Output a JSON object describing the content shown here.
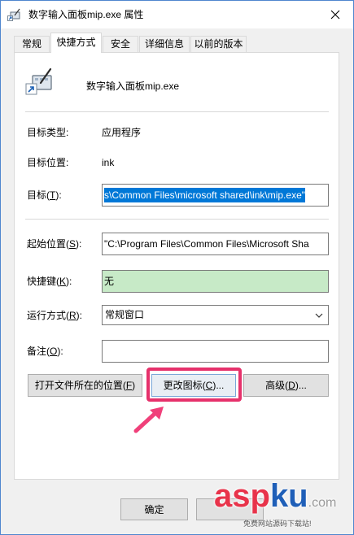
{
  "window": {
    "title": "数字输入面板mip.exe 属性"
  },
  "tabs": [
    {
      "label": "常规"
    },
    {
      "label": "快捷方式",
      "selected": true
    },
    {
      "label": "安全"
    },
    {
      "label": "详细信息"
    },
    {
      "label": "以前的版本"
    }
  ],
  "app": {
    "name": "数字输入面板mip.exe",
    "icon": "shortcut-pen-tablet-icon"
  },
  "fields": {
    "target_type": {
      "label": "目标类型:",
      "value": "应用程序"
    },
    "target_location": {
      "label": "目标位置:",
      "value": "ink"
    },
    "target": {
      "label_prefix": "目标(",
      "label_key": "T",
      "label_suffix": "):",
      "value": "s\\Common Files\\microsoft shared\\ink\\mip.exe\""
    },
    "start_in": {
      "label_prefix": "起始位置(",
      "label_key": "S",
      "label_suffix": "):",
      "value": "\"C:\\Program Files\\Common Files\\Microsoft Sha"
    },
    "shortcut_key": {
      "label_prefix": "快捷键(",
      "label_key": "K",
      "label_suffix": "):",
      "value": "无"
    },
    "run": {
      "label_prefix": "运行方式(",
      "label_key": "R",
      "label_suffix": "):",
      "value": "常规窗口"
    },
    "comment": {
      "label_prefix": "备注(",
      "label_key": "O",
      "label_suffix": "):"
    }
  },
  "buttons": {
    "open_location": {
      "prefix": "打开文件所在的位置(",
      "key": "F",
      "suffix": ")"
    },
    "change_icon": {
      "prefix": "更改图标(",
      "key": "C",
      "suffix": ")..."
    },
    "advanced": {
      "prefix": "高级(",
      "key": "D",
      "suffix": ")..."
    }
  },
  "dialog": {
    "ok_label": "确定"
  },
  "watermark": {
    "part1": "asp",
    "part2": "ku",
    "part3": ".com",
    "tagline": "免费网站源码下载站!"
  },
  "colors": {
    "selection": "#0078d7",
    "shortcut_field_bg": "#c7eac7",
    "highlight_frame": "#e6316b",
    "annotation_arrow": "#f0407a",
    "watermark_red": "#e8334a",
    "watermark_blue": "#1f5fb8"
  }
}
